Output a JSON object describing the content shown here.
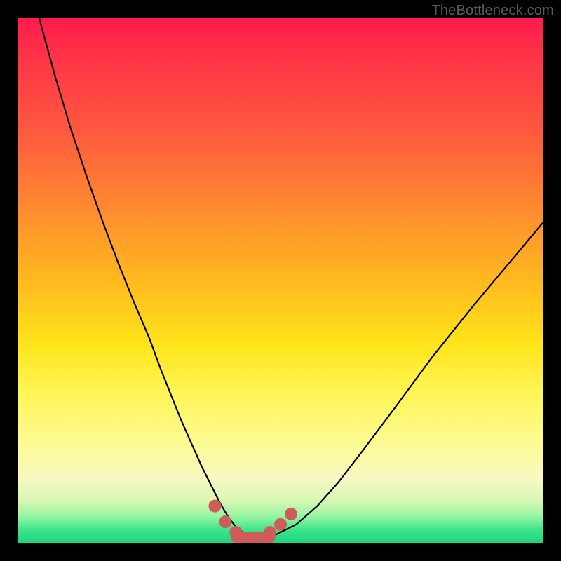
{
  "watermark": "TheBottleneck.com",
  "chart_data": {
    "type": "line",
    "title": "",
    "xlabel": "",
    "ylabel": "",
    "xlim": [
      0,
      100
    ],
    "ylim": [
      0,
      100
    ],
    "series": [
      {
        "name": "bottleneck-curve",
        "x": [
          4,
          7,
          10,
          13,
          16,
          19,
          22,
          25,
          27,
          29,
          31,
          33,
          35,
          37,
          38.5,
          40,
          41.5,
          43.5,
          46,
          49,
          53,
          57,
          61,
          66,
          72,
          79,
          87,
          95,
          100
        ],
        "values": [
          100,
          89,
          79,
          70,
          61.5,
          53.5,
          46,
          39,
          33.5,
          28.5,
          23.5,
          19,
          14.5,
          10.5,
          7.5,
          5,
          3,
          1.5,
          1,
          1.5,
          3.5,
          7,
          11.5,
          18,
          26,
          35.5,
          45.5,
          55,
          61
        ]
      }
    ],
    "markers": {
      "name": "trough-dots",
      "x": [
        37.5,
        39.5,
        41.5,
        48,
        50,
        52
      ],
      "values": [
        7,
        4,
        2,
        2,
        3.5,
        5.5
      ]
    },
    "trough_segment": {
      "x0": 41.5,
      "x1": 48,
      "y": 1
    },
    "background_gradient": {
      "top": "#ff1a4d",
      "mid": "#ffe41a",
      "bottom": "#1dd47e"
    }
  }
}
